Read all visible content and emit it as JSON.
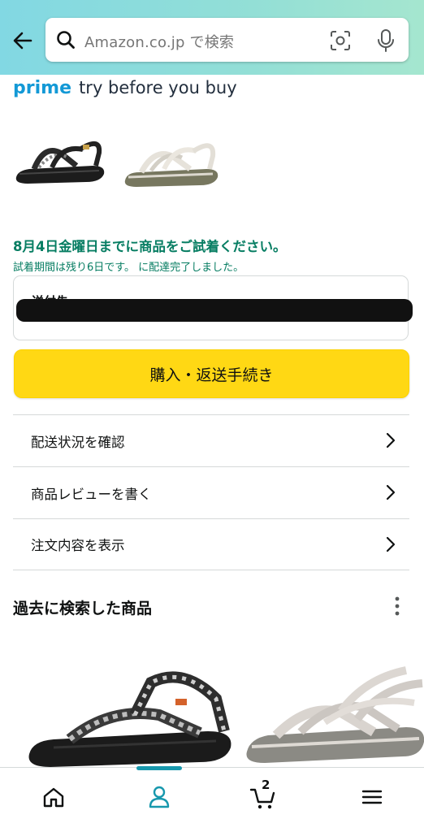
{
  "search": {
    "placeholder": "Amazon.co.jp で検索"
  },
  "prime_banner": {
    "brand": "prime",
    "tagline": "try before you buy"
  },
  "trial": {
    "deadline": "8月4日金曜日までに商品をご試着ください。",
    "remaining": "試着期間は残り6日です。 に配達完了しました。"
  },
  "address": {
    "label": "送付先"
  },
  "primary_action": {
    "label": "購入・返送手続き"
  },
  "menu": {
    "items": [
      {
        "label": "配送状況を確認"
      },
      {
        "label": "商品レビューを書く"
      },
      {
        "label": "注文内容を表示"
      }
    ]
  },
  "history": {
    "title": "過去に検索した商品"
  },
  "bottom_nav": {
    "cart_count": "2",
    "active": "you"
  },
  "colors": {
    "accent_teal": "#1798ad",
    "prime_blue": "#1399d6",
    "success_green": "#067d62",
    "buy_yellow": "#ffd814"
  },
  "icons": [
    "back-arrow-icon",
    "search-icon",
    "camera-scan-icon",
    "microphone-icon",
    "chevron-right-icon",
    "more-vertical-icon",
    "home-icon",
    "user-icon",
    "cart-icon",
    "hamburger-menu-icon"
  ]
}
